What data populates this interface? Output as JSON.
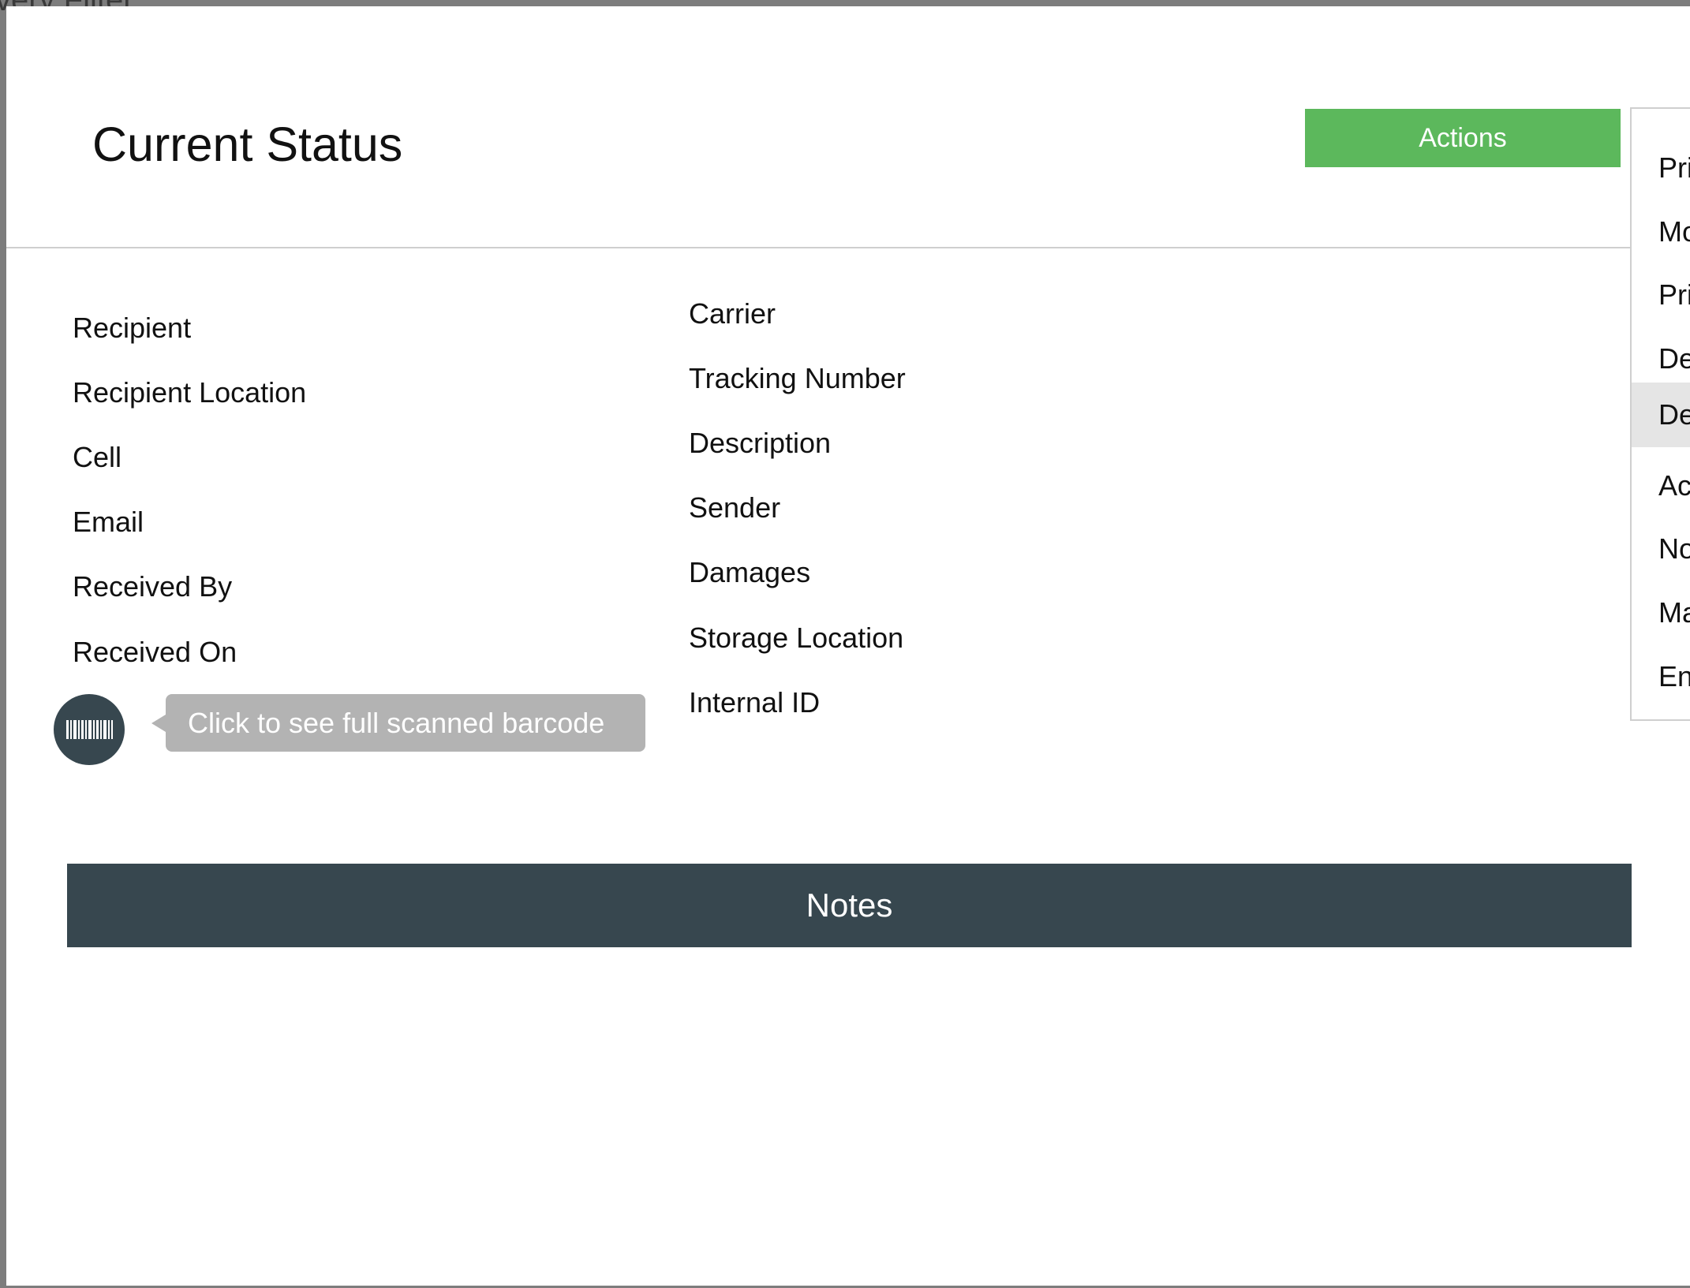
{
  "backdrop": {
    "partial_title": "very Filter"
  },
  "modal": {
    "title": "Current Status",
    "actions_label": "Actions",
    "actions_menu": {
      "items": [
        {
          "label": "Pri"
        },
        {
          "label": "Mo"
        },
        {
          "label": "Pri"
        },
        {
          "label": "De"
        },
        {
          "label": "De",
          "highlighted": true
        },
        {
          "label": "Ac"
        },
        {
          "label": "No"
        },
        {
          "label": "Ma"
        },
        {
          "label": "En"
        }
      ]
    },
    "left_fields": [
      {
        "label": "Recipient"
      },
      {
        "label": "Recipient Location"
      },
      {
        "label": "Cell"
      },
      {
        "label": "Email"
      },
      {
        "label": "Received By"
      },
      {
        "label": "Received On"
      }
    ],
    "right_fields": [
      {
        "label": "Carrier"
      },
      {
        "label": "Tracking Number"
      },
      {
        "label": "Description"
      },
      {
        "label": "Sender"
      },
      {
        "label": "Damages"
      },
      {
        "label": "Storage Location"
      },
      {
        "label": "Internal ID"
      }
    ],
    "barcode": {
      "icon": "barcode-icon",
      "tooltip": "Click to see full scanned barcode"
    },
    "notes_label": "Notes"
  },
  "colors": {
    "actions_green": "#5cb85c",
    "dark_slate": "#37474f",
    "tooltip_gray": "#b3b3b3",
    "highlight_gray": "#e5e5e5"
  }
}
